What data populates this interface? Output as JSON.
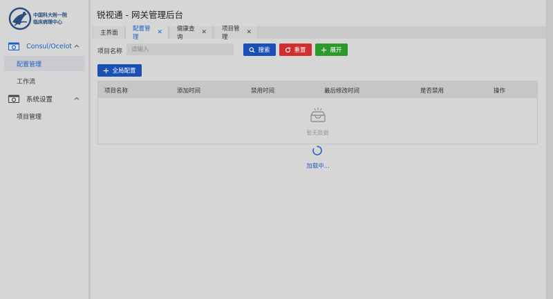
{
  "brand": {
    "logo_line1": "中国科大附一院",
    "logo_line2": "临床病理中心"
  },
  "app": {
    "title": "锐视通 - 网关管理后台"
  },
  "sidebar": {
    "groups": [
      {
        "label": "Consul/Ocelot",
        "icon": "camera-icon",
        "items": [
          {
            "label": "配置管理",
            "active": true
          },
          {
            "label": "工作流",
            "active": false
          }
        ]
      },
      {
        "label": "系统设置",
        "icon": "camera-icon",
        "items": [
          {
            "label": "项目管理",
            "active": false
          }
        ]
      }
    ]
  },
  "tabs": [
    {
      "label": "主界面",
      "closable": false
    },
    {
      "label": "配置管理",
      "closable": true,
      "active": true
    },
    {
      "label": "健康查询",
      "closable": true
    },
    {
      "label": "项目管理",
      "closable": true
    }
  ],
  "tab_close_glyph": "✕",
  "search": {
    "label": "项目名称",
    "placeholder": "请输入",
    "value": "",
    "search_label": "搜索",
    "reset_label": "重置",
    "expand_label": "展开"
  },
  "toolbar": {
    "add_label": "全局配置"
  },
  "table": {
    "columns": [
      "项目名称",
      "添加时间",
      "禁用时间",
      "最后修改时间",
      "是否禁用",
      "操作"
    ],
    "rows": [],
    "empty_text": "暂无数据"
  },
  "loading": {
    "text": "加载中..."
  },
  "colors": {
    "primary": "#1a4fb8",
    "danger": "#cf2f2f",
    "success": "#2b9a2b",
    "active_text": "#1f5fbf"
  }
}
